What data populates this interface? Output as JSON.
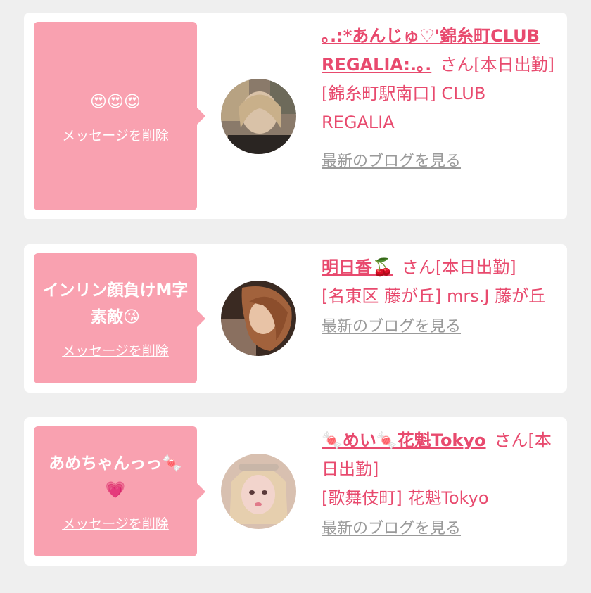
{
  "delete_label": "メッセージを削除",
  "blog_label": "最新のブログを見る",
  "san_label": "さん",
  "messages": [
    {
      "text": "😍😍😍",
      "name": "｡.:*あんじゅ♡'錦糸町CLUB REGALIA:.｡.",
      "status": "[本日出勤]",
      "location": "[錦糸町駅南口] CLUB REGALIA"
    },
    {
      "text": "インリン顔負けM字素敵😘",
      "name": "明日香🍒",
      "status": "[本日出勤]",
      "location": "[名東区 藤が丘] mrs.J 藤が丘"
    },
    {
      "text": "あめちゃんっっ🍬💗",
      "name": "🍬めい🍬花魁Tokyo",
      "status": "[本日出勤]",
      "location": "[歌舞伎町] 花魁Tokyo"
    }
  ],
  "colors": {
    "bubble": "#f9a1b0",
    "accent": "#e84a6e",
    "muted": "#9a9a9a",
    "background": "#efefef"
  }
}
